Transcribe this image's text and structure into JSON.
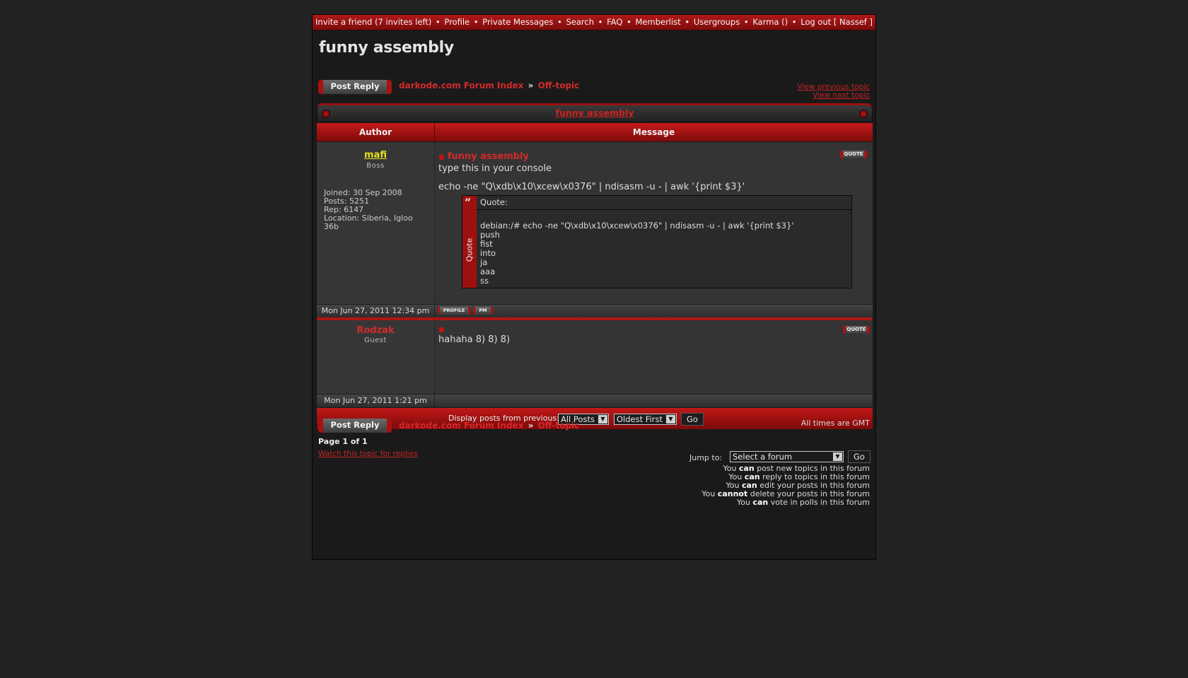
{
  "topnav": {
    "items": [
      "Invite a friend (7 invites left)",
      "Profile",
      "Private Messages",
      "Search",
      "FAQ",
      "Memberlist",
      "Usergroups",
      "Karma ()",
      "Log out [ Nassef ]"
    ],
    "separator": "•"
  },
  "page": {
    "title": "funny assembly"
  },
  "toolbar": {
    "post_reply_label": "Post Reply"
  },
  "breadcrumb": {
    "forum_index": "darkode.com Forum Index",
    "separator": "»",
    "subforum": "Off-topic"
  },
  "topic_nav": {
    "previous": "View previous topic",
    "next": "View next topic"
  },
  "topic_box": {
    "title": "funny assembly"
  },
  "table_header": {
    "author": "Author",
    "message": "Message"
  },
  "posts": [
    {
      "author": "mafi",
      "author_color": "#e8e020",
      "rank": "Boss",
      "info": [
        "Joined: 30 Sep 2008",
        "Posts: 5251",
        "Rep: 6147",
        "Location: Siberia, Igloo 36b"
      ],
      "subject": "funny assembly",
      "text_lines": [
        "type this in your console",
        "echo -ne \"Q\\xdb\\x10\\xcew\\x0376\" | ndisasm -u - | awk '{print $3}'"
      ],
      "quote": {
        "side_label": "Quote",
        "head": "Quote:",
        "lines": [
          "debian:/# echo -ne \"Q\\xdb\\x10\\xcew\\x0376\" | ndisasm -u - | awk '{print $3}'",
          "push",
          "fist",
          "into",
          "ja",
          "aaa",
          "ss"
        ]
      },
      "date": "Mon Jun 27, 2011 12:34 pm",
      "quote_button": "QUOTE",
      "profile_button": "PROFILE",
      "pm_button": "PM"
    },
    {
      "author": "Rodzak",
      "author_color": "#d42a2a",
      "rank": "Guest",
      "subject": "",
      "text_lines": [
        "hahaha 8) 8) 8)"
      ],
      "date": "Mon Jun 27, 2011 1:21 pm",
      "quote_button": "QUOTE"
    }
  ],
  "display_bar": {
    "label": "Display posts from previous:",
    "posts_select": "All Posts",
    "order_select": "Oldest First",
    "go_label": "Go"
  },
  "footer": {
    "timezone": "All times are GMT",
    "pagination": "Page 1 of 1",
    "watch_link": "Watch this topic for replies",
    "jump_label": "Jump to:",
    "jump_select": "Select a forum",
    "jump_go": "Go",
    "permissions": [
      {
        "pre": "You ",
        "verb": "can",
        "post": " post new topics in this forum"
      },
      {
        "pre": "You ",
        "verb": "can",
        "post": " reply to topics in this forum"
      },
      {
        "pre": "You ",
        "verb": "can",
        "post": " edit your posts in this forum"
      },
      {
        "pre": "You ",
        "verb": "cannot",
        "post": " delete your posts in this forum"
      },
      {
        "pre": "You ",
        "verb": "can",
        "post": " vote in polls in this forum"
      }
    ]
  },
  "colors": {
    "accent_red": "#b01414",
    "link_red": "#d42a2a",
    "background": "#222222"
  }
}
